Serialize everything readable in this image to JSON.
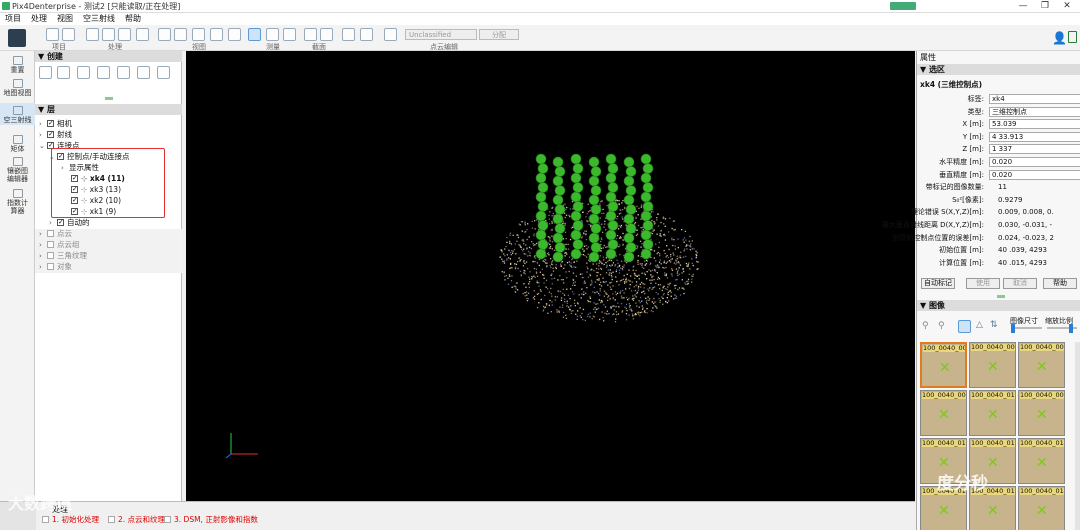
{
  "window": {
    "title": "Pix4Denterprise - 测试2 [只能读取/正在处理]",
    "minimize": "—",
    "maximize": "❐",
    "close": "✕"
  },
  "menu": [
    "项目",
    "处理",
    "视图",
    "空三射线",
    "帮助"
  ],
  "toolbar": {
    "groups": [
      "项目",
      "处理",
      "视图",
      "测量",
      "截面",
      "点云编辑"
    ],
    "class_select": "Unclassified",
    "assign_button": "分配"
  },
  "leftcol": {
    "items": [
      "重置",
      "地图视图",
      "空三射线",
      "矩体",
      "镶嵌图编辑器",
      "指数计算器"
    ]
  },
  "layers": {
    "create_header": "创建",
    "layers_header": "层",
    "cameras": "相机",
    "rays": "射线",
    "tiepoints": "连接点",
    "gcp_group": "控制点/手动连接点",
    "display_props": "显示属性",
    "points": [
      {
        "name": "xk4 (11)",
        "bold": true
      },
      {
        "name": "xk3 (13)",
        "bold": false
      },
      {
        "name": "xk2 (10)",
        "bold": false
      },
      {
        "name": "xk1 (9)",
        "bold": false
      }
    ],
    "auto": "自动的",
    "pointcloud": "点云",
    "pointcloud_group": "点云组",
    "triangle_texture": "三角纹理",
    "objects": "对象"
  },
  "bottom": {
    "header": "处理",
    "watermark_left": "大数跨境",
    "step1": "1. 初始化处理",
    "step2": "2. 点云和纹理",
    "step3": "3. DSM, 正射影像和指数"
  },
  "properties": {
    "panel_title": "属性",
    "section_title": "选区",
    "point_title": "xk4 (三维控制点)",
    "rows": [
      {
        "label": "标签:",
        "value": "xk4",
        "field": true
      },
      {
        "label": "类型:",
        "value": "三维控制点",
        "field": true
      },
      {
        "label": "X [m]:",
        "value": "53.039",
        "field": true
      },
      {
        "label": "Y [m]:",
        "value": "4 33.913",
        "field": true
      },
      {
        "label": "Z [m]:",
        "value": "1 337",
        "field": true
      },
      {
        "label": "水平精度 [m]:",
        "value": "0.020",
        "field": true
      },
      {
        "label": "垂直精度 [m]:",
        "value": "0.020",
        "field": true
      },
      {
        "label": "带标记的图像数量:",
        "value": "11",
        "field": false
      },
      {
        "label": "S₀²[像素]:",
        "value": "0.9279",
        "field": false
      },
      {
        "label": "理论错误 S(X,Y,Z)[m]:",
        "value": "0.009, 0.008, 0.",
        "field": false
      },
      {
        "label": "最大垂直射线距离 D(X,Y,Z)[m]:",
        "value": "0.030, -0.031, -",
        "field": false
      },
      {
        "label": "到原始控制点位置的误差[m]:",
        "value": "0.024, -0.023, 2",
        "field": false
      },
      {
        "label": "初始位置 [m]:",
        "value": "40 .039, 4293",
        "field": false
      },
      {
        "label": "计算位置 [m]:",
        "value": "40 .015, 4293",
        "field": false
      }
    ],
    "buttons": [
      "自动标记",
      "使用",
      "取消",
      "帮助"
    ]
  },
  "images": {
    "section_title": "图像",
    "image_size_label": "图像尺寸",
    "zoom_label": "缩放比例",
    "thumbs": [
      "100_0040_00",
      "100_0040_00",
      "100_0040_00",
      "100_0040_00",
      "100_0040_01",
      "100_0040_00",
      "100_0040_01",
      "100_0040_01",
      "100_0040_01",
      "100_0040_01",
      "100_0040_01",
      "100_0040_01"
    ],
    "watermark": "度分秒"
  },
  "colors": {
    "accent": "#5a9bd5",
    "selected_thumb": "#e07b22",
    "highlight_box": "#e03030",
    "gcp_green": "#3cb82c"
  }
}
